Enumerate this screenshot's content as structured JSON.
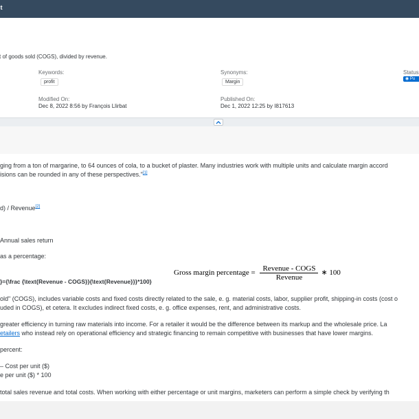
{
  "app": {
    "title": "it"
  },
  "header": {
    "description": "t of goods sold (COGS), divided by revenue.",
    "keywords_label": "Keywords:",
    "keywords_tag": "profit",
    "synonyms_label": "Synonyms:",
    "synonyms_tag": "Margin",
    "status_label": "Status",
    "status_value": "Pu",
    "modified_label": "Modified On:",
    "modified_value": "Dec 8, 2022 8:56 by François Llirbat",
    "published_label": "Published On:",
    "published_value": "Dec 1, 2022 12:25 by I817613"
  },
  "content": {
    "line1": "ging from a ton of margarine, to 64 ounces of cola, to a bucket of plaster. Many industries work with multiple units and calculate margin accord",
    "line2_text": "isions can be rounded in any of these perspectives.\"",
    "line2_ref": "[1]",
    "line3_text": "d) / Revenue",
    "line3_ref": "[2]",
    "line4": "Annual sales return",
    "line5": "as a percentage:",
    "latex_source": "}={\\frac {\\text{Revenue - COGS}}{\\text{Revenue}}}*100}",
    "formula_lhs": "Gross margin percentage = ",
    "formula_num": "Revenue - COGS",
    "formula_den": "Revenue",
    "formula_rhs": "∗ 100",
    "line6": "old\" (COGS), includes variable costs and fixed costs directly related to the sale, e. g. material costs, labor, supplier profit, shipping-in costs (cost o",
    "line7": "uded in COGS), et cetera. It excludes indirect fixed costs, e. g. office expenses, rent, and administrative costs.",
    "line8": "greater efficiency in turning raw materials into income. For a retailer it would be the difference between its markup and the wholesale price. La",
    "line9_link": "etailers",
    "line9_rest": " who instead rely on operational efficiency and strategic financing to remain competitive with businesses that have lower margins.",
    "line10": "percent:",
    "line11": "– Cost per unit ($)",
    "line12": "e per unit ($) * 100",
    "line13": "total sales revenue and total costs. When working with either percentage or unit margins, marketers can perform a simple check by verifying th"
  }
}
